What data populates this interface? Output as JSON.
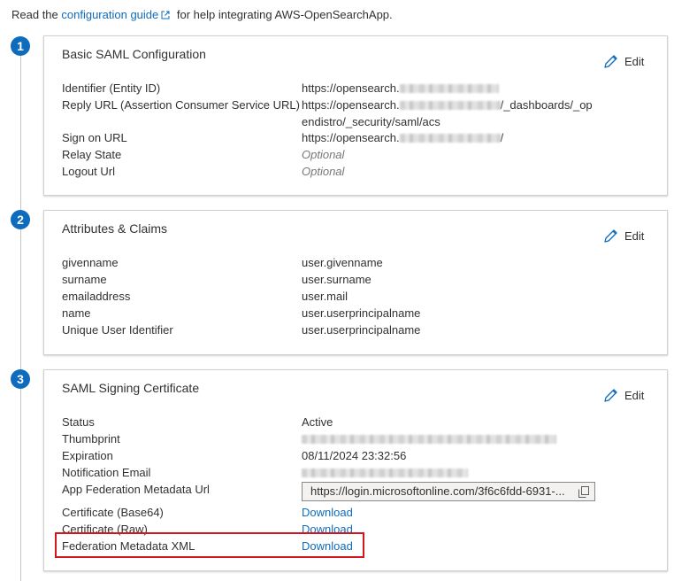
{
  "intro": {
    "prefix": "Read the",
    "link": "configuration guide",
    "suffix": "for help integrating AWS-OpenSearchApp."
  },
  "steps": [
    "1",
    "2",
    "3"
  ],
  "edit_label": "Edit",
  "basic_saml": {
    "title": "Basic SAML Configuration",
    "identifier_label": "Identifier (Entity ID)",
    "identifier_value": "https://opensearch.",
    "reply_label": "Reply URL (Assertion Consumer Service URL)",
    "reply_value_1a": "https://opensearch.",
    "reply_value_1b": "/_dashboards/_op",
    "reply_value_2": "endistro/_security/saml/acs",
    "signon_label": "Sign on URL",
    "signon_value_a": "https://opensearch.",
    "signon_value_b": "/",
    "relay_label": "Relay State",
    "relay_value": "Optional",
    "logout_label": "Logout Url",
    "logout_value": "Optional"
  },
  "attributes": {
    "title": "Attributes & Claims",
    "rows": [
      {
        "label": "givenname",
        "value": "user.givenname"
      },
      {
        "label": "surname",
        "value": "user.surname"
      },
      {
        "label": "emailaddress",
        "value": "user.mail"
      },
      {
        "label": "name",
        "value": "user.userprincipalname"
      },
      {
        "label": "Unique User Identifier",
        "value": "user.userprincipalname"
      }
    ]
  },
  "certificate": {
    "title": "SAML Signing Certificate",
    "status_label": "Status",
    "status_value": "Active",
    "thumbprint_label": "Thumbprint",
    "expiration_label": "Expiration",
    "expiration_value": "08/11/2024 23:32:56",
    "email_label": "Notification Email",
    "metadata_url_label": "App Federation Metadata Url",
    "metadata_url_value": "https://login.microsoftonline.com/3f6c6fdd-6931-...",
    "base64_label": "Certificate (Base64)",
    "raw_label": "Certificate (Raw)",
    "xml_label": "Federation Metadata XML",
    "download_label": "Download"
  },
  "colors": {
    "accent": "#0f6cbd",
    "highlight": "#d0161f"
  }
}
